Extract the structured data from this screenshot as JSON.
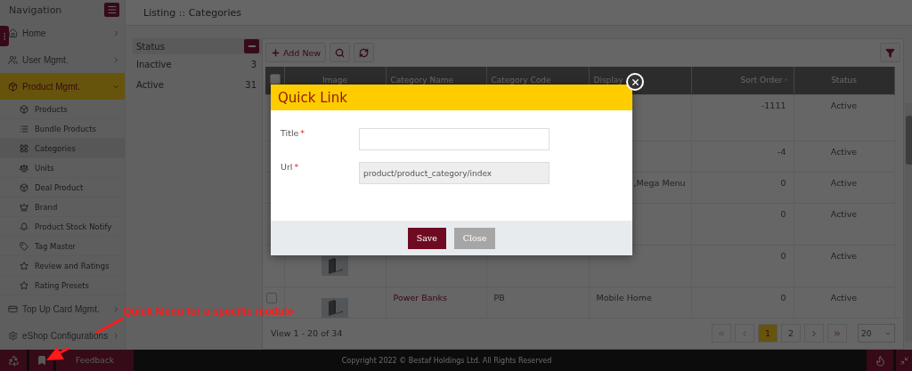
{
  "sidebar": {
    "title": "Navigation",
    "items": [
      {
        "label": "Home",
        "expanded": false,
        "selected": false
      },
      {
        "label": "User Mgmt.",
        "expanded": false,
        "selected": false
      },
      {
        "label": "Product Mgmt.",
        "expanded": true,
        "selected": true,
        "children": [
          {
            "label": "Products",
            "selected": false
          },
          {
            "label": "Bundle Products",
            "selected": false
          },
          {
            "label": "Categories",
            "selected": true
          },
          {
            "label": "Units",
            "selected": false
          },
          {
            "label": "Deal Product",
            "selected": false
          },
          {
            "label": "Brand",
            "selected": false
          },
          {
            "label": "Product Stock Notify",
            "selected": false
          },
          {
            "label": "Tag Master",
            "selected": false
          },
          {
            "label": "Review and Ratings",
            "selected": false
          },
          {
            "label": "Rating Presets",
            "selected": false
          }
        ]
      },
      {
        "label": "Top Up Card Mgmt.",
        "expanded": false,
        "selected": false
      },
      {
        "label": "eShop Configurations",
        "expanded": false,
        "selected": false
      }
    ]
  },
  "page_title": "Listing :: Categories",
  "filter": {
    "title": "Status",
    "options": [
      {
        "label": "Inactive",
        "count": "3"
      },
      {
        "label": "Active",
        "count": "31"
      }
    ]
  },
  "toolbar": {
    "add_label": "Add New"
  },
  "table": {
    "select_all_checked": false,
    "columns": [
      "Image",
      "Category Name",
      "Category Code",
      "Display",
      "Sort Order",
      "Status"
    ],
    "rows": [
      {
        "sort_order": "-1111",
        "status": "Active"
      },
      {
        "sort_order": "-4",
        "status": "Active"
      },
      {
        "display": ",Mega Menu",
        "display_clipped": true,
        "sort_order": "0",
        "status": "Active"
      },
      {
        "sort_order": "0",
        "status": "Active"
      },
      {
        "image": true,
        "sort_order": "0",
        "status": "Active"
      },
      {
        "checked": false,
        "image": true,
        "name": "Power Banks",
        "code": "PB",
        "display": "Mobile Home",
        "sort_order": "0",
        "status": "Active"
      }
    ]
  },
  "pagination": {
    "summary": "View 1 - 20 of 34",
    "pages": [
      {
        "label": "1",
        "selected": true
      },
      {
        "label": "2",
        "selected": false
      }
    ],
    "page_size": "20"
  },
  "footer": {
    "feedback": "Feedback",
    "copyright": "Copyright 2022 © Bestaf Holdings Ltd. All Rights Reserved"
  },
  "dialog": {
    "title": "Quick Link",
    "fields": [
      {
        "label": "Title",
        "required_mark": "*",
        "disabled": false
      },
      {
        "label": "Url",
        "required_mark": "*",
        "value": "product/product_category/index",
        "disabled": true
      }
    ],
    "save": "Save",
    "close": "Close"
  },
  "annotation": "Quick Menu for a specific module"
}
